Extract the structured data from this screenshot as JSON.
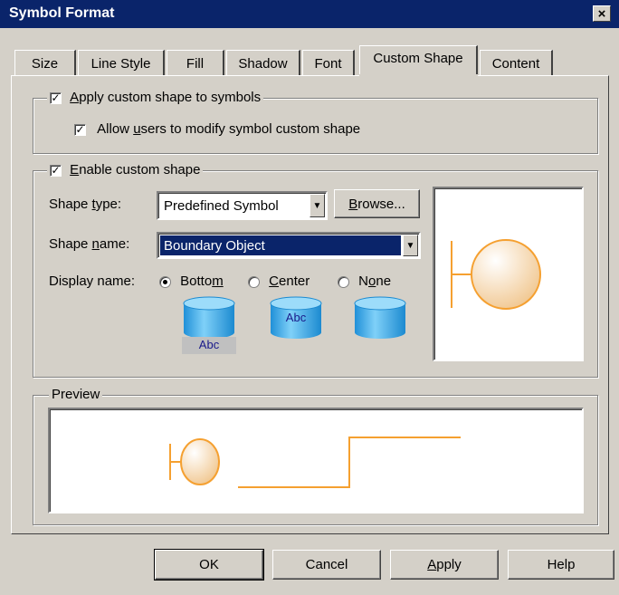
{
  "window": {
    "title": "Symbol Format",
    "close_glyph": "×"
  },
  "tabs": [
    {
      "label": "Size"
    },
    {
      "label": "Line Style"
    },
    {
      "label": "Fill"
    },
    {
      "label": "Shadow"
    },
    {
      "label": "Font"
    },
    {
      "label": "Custom Shape",
      "active": true
    },
    {
      "label": "Content"
    }
  ],
  "apply_group": {
    "apply_prefix": "",
    "apply_u": "A",
    "apply_rest": "pply custom shape to symbols",
    "allow_prefix": "Allow ",
    "allow_u": "u",
    "allow_rest": "sers to modify symbol custom shape",
    "apply_checked": true,
    "allow_checked": true
  },
  "enable_group": {
    "enable_prefix": "",
    "enable_u": "E",
    "enable_rest": "nable custom shape",
    "enable_checked": true,
    "shape_type_prefix": "Shape ",
    "shape_type_u": "t",
    "shape_type_rest": "ype:",
    "shape_type_value": "Predefined Symbol",
    "browse_prefix": "",
    "browse_u": "B",
    "browse_rest": "rowse...",
    "shape_name_prefix": "Shape ",
    "shape_name_u": "n",
    "shape_name_rest": "ame:",
    "shape_name_value": "Boundary Object",
    "display_name_label": "Display name:",
    "radios": [
      {
        "prefix": "Botto",
        "u": "m",
        "rest": "",
        "checked": true
      },
      {
        "prefix": "",
        "u": "C",
        "rest": "enter",
        "checked": false
      },
      {
        "prefix": "N",
        "u": "o",
        "rest": "ne",
        "checked": false
      }
    ],
    "sample_text_bottom": "Abc",
    "sample_text_center": "Abc"
  },
  "preview": {
    "label": "Preview"
  },
  "buttons": {
    "ok": "OK",
    "cancel": "Cancel",
    "apply_prefix": "",
    "apply_u": "A",
    "apply_rest": "pply",
    "help": "Help"
  },
  "colors": {
    "title_bar": "#0a246a",
    "selection": "#0a246a",
    "shape_stroke": "#f5a030",
    "shape_fill": "#f6d7a8",
    "cylinder": "#2ea8e8"
  },
  "icons": {
    "close": "close-icon",
    "dropdown": "chevron-down-icon",
    "boundary_object": "boundary-object-icon"
  }
}
